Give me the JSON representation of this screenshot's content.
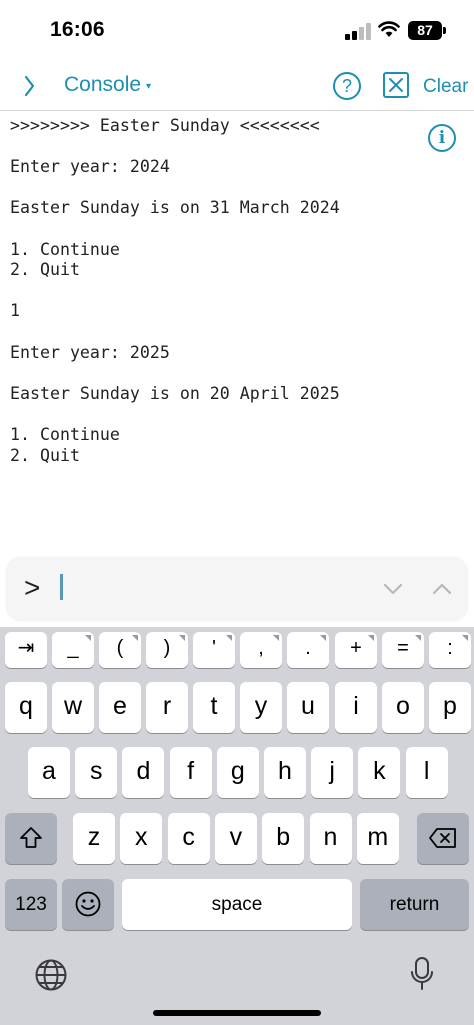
{
  "status": {
    "time": "16:06",
    "battery": "87"
  },
  "nav": {
    "title": "Console",
    "caret": "▾",
    "help": "?",
    "clear": "Clear"
  },
  "console": {
    "lines": [
      ">>>>>>>> Easter Sunday <<<<<<<<",
      "",
      "Enter year: 2024",
      "",
      "Easter Sunday is on 31 March 2024",
      "",
      "1. Continue",
      "2. Quit",
      "",
      "1",
      "",
      "Enter year: 2025",
      "",
      "Easter Sunday is on 20 April 2025",
      "",
      "1. Continue",
      "2. Quit"
    ],
    "info": "i"
  },
  "input": {
    "prompt": ">",
    "value": ""
  },
  "keyboard": {
    "symbols": [
      "⇥",
      "_",
      "(",
      ")",
      "'",
      ",",
      ".",
      "+",
      "=",
      ":"
    ],
    "row1": [
      "q",
      "w",
      "e",
      "r",
      "t",
      "y",
      "u",
      "i",
      "o",
      "p"
    ],
    "row2": [
      "a",
      "s",
      "d",
      "f",
      "g",
      "h",
      "j",
      "k",
      "l"
    ],
    "row3": [
      "z",
      "x",
      "c",
      "v",
      "b",
      "n",
      "m"
    ],
    "numbers": "123",
    "emoji": "☺",
    "space": "space",
    "return": "return"
  },
  "colors": {
    "accent": "#1d8fb2",
    "keyboard_bg": "#d1d3d9",
    "fn_key": "#abb0ba"
  }
}
